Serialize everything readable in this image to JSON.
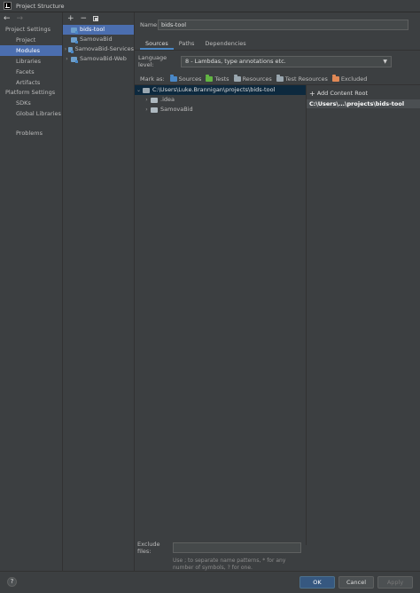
{
  "window": {
    "title": "Project Structure"
  },
  "sidebar": {
    "project_settings_heading": "Project Settings",
    "project_settings": [
      {
        "label": "Project"
      },
      {
        "label": "Modules",
        "selected": true
      },
      {
        "label": "Libraries"
      },
      {
        "label": "Facets"
      },
      {
        "label": "Artifacts"
      }
    ],
    "platform_settings_heading": "Platform Settings",
    "platform_settings": [
      {
        "label": "SDKs"
      },
      {
        "label": "Global Libraries"
      }
    ],
    "problems": "Problems"
  },
  "modules": {
    "toolbar": {
      "add": "+",
      "remove": "−"
    },
    "items": [
      {
        "label": "bids-tool",
        "selected": true,
        "expandable": false
      },
      {
        "label": "SamovaBid",
        "expandable": false
      },
      {
        "label": "SamovaBid-Services",
        "expandable": true
      },
      {
        "label": "SamovaBid-Web",
        "expandable": true
      }
    ]
  },
  "detail": {
    "name_label": "Name:",
    "name_value": "bids-tool",
    "tabs": [
      {
        "label": "Sources",
        "active": true
      },
      {
        "label": "Paths"
      },
      {
        "label": "Dependencies"
      }
    ],
    "language_level_label": "Language level:",
    "language_level_value": "8 - Lambdas, type annotations etc.",
    "mark_as_label": "Mark as:",
    "mark_as": [
      {
        "label": "Sources",
        "color": "#4a88c7"
      },
      {
        "label": "Tests",
        "color": "#62b543"
      },
      {
        "label": "Resources",
        "color": "#9aa7b0"
      },
      {
        "label": "Test Resources",
        "color": "#9aa7b0"
      },
      {
        "label": "Excluded",
        "color": "#e08855"
      }
    ],
    "tree": {
      "root": "C:\\Users\\Luke.Brannigan\\projects\\bids-tool",
      "children": [
        ".idea",
        "SamovaBid"
      ]
    },
    "content_roots": {
      "add_label": "Add Content Root",
      "path": "C:\\Users\\...\\projects\\bids-tool"
    },
    "exclude_label": "Exclude files:",
    "exclude_value": "",
    "exclude_hint": "Use ; to separate name patterns, * for any number of symbols, ? for one."
  },
  "footer": {
    "help": "?",
    "ok": "OK",
    "cancel": "Cancel",
    "apply": "Apply"
  },
  "colors": {
    "background": "#3c3f41",
    "selection": "#4b6eaf",
    "accent": "#4a88c7",
    "ok_button": "#365880"
  }
}
